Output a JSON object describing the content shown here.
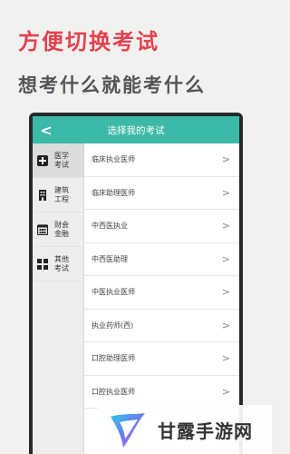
{
  "promo": {
    "title": "方便切换考试",
    "subtitle": "想考什么就能考什么"
  },
  "header": {
    "back_icon": "chevron-left-icon",
    "title": "选择我的考试"
  },
  "sidebar": {
    "categories": [
      {
        "label": "医学考试",
        "icon": "plus-square-icon",
        "active": true
      },
      {
        "label": "建筑工程",
        "icon": "building-icon",
        "active": false
      },
      {
        "label": "财会金融",
        "icon": "calculator-icon",
        "active": false
      },
      {
        "label": "其他考试",
        "icon": "grid-icon",
        "active": false
      }
    ]
  },
  "exams": [
    {
      "label": "临床执业医师"
    },
    {
      "label": "临床助理医师"
    },
    {
      "label": "中西医执业"
    },
    {
      "label": "中西医助理"
    },
    {
      "label": "中医执业医师"
    },
    {
      "label": "执业药师(西)"
    },
    {
      "label": "口腔助理医师"
    },
    {
      "label": "口腔执业医师"
    }
  ],
  "watermark": {
    "text": "甘露手游网"
  },
  "colors": {
    "accent": "#3cb9a7",
    "promo_red": "#e4424e"
  }
}
